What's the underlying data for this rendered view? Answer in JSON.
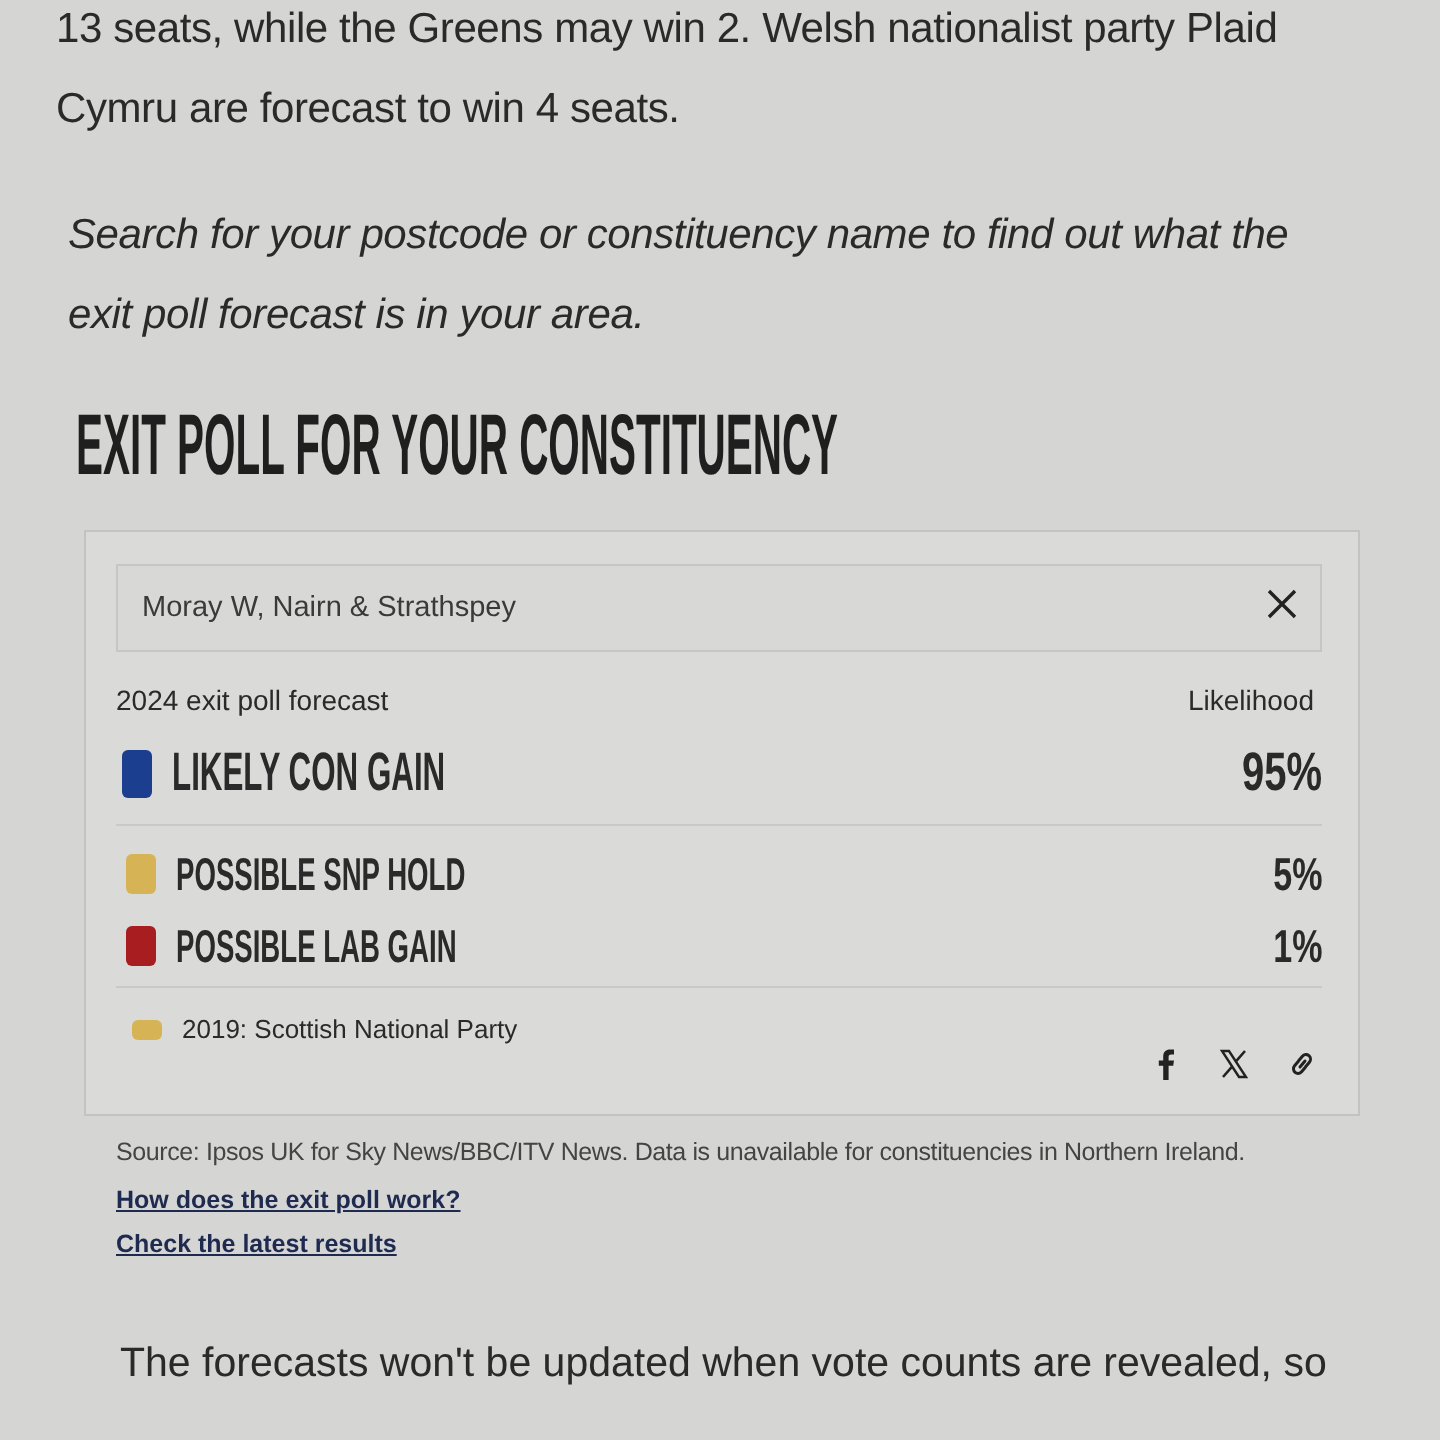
{
  "article_top": [
    {
      "text": "13 seats, while the Greens may win 2. Welsh nationalist party Plaid Cymru are forecast to win 4 seats.",
      "italic": false
    },
    {
      "text": "Search for your postcode or constituency name to find out what the exit poll forecast is in your area.",
      "italic": true
    }
  ],
  "widget": {
    "title": "EXIT POLL FOR YOUR CONSTITUENCY",
    "search": {
      "value": "Moray W, Nairn & Strathspey"
    },
    "forecast_label": "2024 exit poll forecast",
    "likelihood_label": "Likelihood",
    "outcomes": [
      {
        "kind": "leading",
        "label": "LIKELY CON GAIN",
        "likelihood": "95%",
        "color": "#1b3e8e"
      },
      {
        "kind": "other",
        "label": "POSSIBLE SNP HOLD",
        "likelihood": "5%",
        "color": "#d6b456"
      },
      {
        "kind": "other",
        "label": "POSSIBLE LAB GAIN",
        "likelihood": "1%",
        "color": "#a81d1f"
      }
    ],
    "previous": {
      "text": "2019: Scottish National Party",
      "color": "#d6b456"
    },
    "share_buttons": [
      {
        "kind": "facebook"
      },
      {
        "kind": "x"
      },
      {
        "kind": "link"
      }
    ]
  },
  "source": "Source: Ipsos UK for Sky News/BBC/ITV News. Data is unavailable for constituencies in Northern Ireland.",
  "links": [
    "How does the exit poll work?",
    "Check the latest results"
  ],
  "article_bottom": "The forecasts won't be updated when vote counts are revealed, so"
}
